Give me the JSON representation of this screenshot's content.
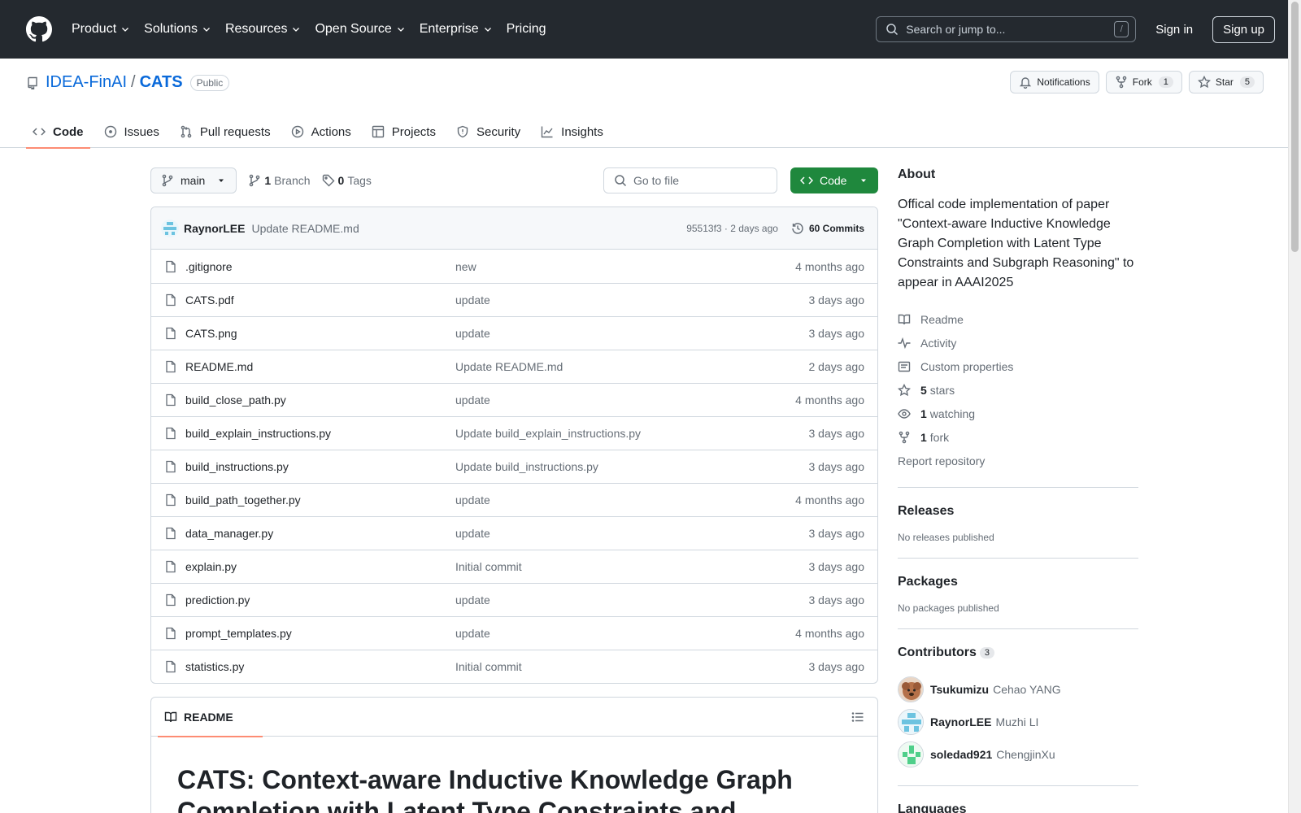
{
  "header": {
    "nav": [
      "Product",
      "Solutions",
      "Resources",
      "Open Source",
      "Enterprise",
      "Pricing"
    ],
    "search_placeholder": "Search or jump to...",
    "search_key": "/",
    "sign_in": "Sign in",
    "sign_up": "Sign up"
  },
  "repo": {
    "owner": "IDEA-FinAI",
    "separator": "/",
    "name": "CATS",
    "visibility": "Public",
    "notifications_label": "Notifications",
    "fork_label": "Fork",
    "fork_count": "1",
    "star_label": "Star",
    "star_count": "5",
    "tabs": [
      "Code",
      "Issues",
      "Pull requests",
      "Actions",
      "Projects",
      "Security",
      "Insights"
    ]
  },
  "toolbar": {
    "branch": "main",
    "branch_count": "1",
    "branch_label": "Branch",
    "tag_count": "0",
    "tag_label": "Tags",
    "goto_placeholder": "Go to file",
    "code_label": "Code"
  },
  "commit": {
    "author": "RaynorLEE",
    "message": "Update README.md",
    "meta": "95513f3 · 2 days ago",
    "count_label": "60 Commits"
  },
  "files": [
    {
      "name": ".gitignore",
      "message": "new",
      "age": "4 months ago"
    },
    {
      "name": "CATS.pdf",
      "message": "update",
      "age": "3 days ago"
    },
    {
      "name": "CATS.png",
      "message": "update",
      "age": "3 days ago"
    },
    {
      "name": "README.md",
      "message": "Update README.md",
      "age": "2 days ago"
    },
    {
      "name": "build_close_path.py",
      "message": "update",
      "age": "4 months ago"
    },
    {
      "name": "build_explain_instructions.py",
      "message": "Update build_explain_instructions.py",
      "age": "3 days ago"
    },
    {
      "name": "build_instructions.py",
      "message": "Update build_instructions.py",
      "age": "3 days ago"
    },
    {
      "name": "build_path_together.py",
      "message": "update",
      "age": "4 months ago"
    },
    {
      "name": "data_manager.py",
      "message": "update",
      "age": "3 days ago"
    },
    {
      "name": "explain.py",
      "message": "Initial commit",
      "age": "3 days ago"
    },
    {
      "name": "prediction.py",
      "message": "update",
      "age": "3 days ago"
    },
    {
      "name": "prompt_templates.py",
      "message": "update",
      "age": "4 months ago"
    },
    {
      "name": "statistics.py",
      "message": "Initial commit",
      "age": "3 days ago"
    }
  ],
  "readme": {
    "tab_label": "README",
    "title": "CATS: Context-aware Inductive Knowledge Graph Completion with Latent Type Constraints and"
  },
  "about": {
    "heading": "About",
    "description": "Offical code implementation of paper \"Context-aware Inductive Knowledge Graph Completion with Latent Type Constraints and Subgraph Reasoning\" to appear in AAAI2025",
    "readme": "Readme",
    "activity": "Activity",
    "custom_properties": "Custom properties",
    "stars_count": "5",
    "stars_label": "stars",
    "watching_count": "1",
    "watching_label": "watching",
    "forks_count": "1",
    "forks_label": "fork",
    "report": "Report repository"
  },
  "releases": {
    "heading": "Releases",
    "empty": "No releases published"
  },
  "packages": {
    "heading": "Packages",
    "empty": "No packages published"
  },
  "contributors": {
    "heading": "Contributors",
    "count": "3",
    "list": [
      {
        "login": "Tsukumizu",
        "name": "Cehao YANG"
      },
      {
        "login": "RaynorLEE",
        "name": "Muzhi LI"
      },
      {
        "login": "soledad921",
        "name": "ChengjinXu"
      }
    ]
  },
  "languages_heading": "Languages",
  "colors": {
    "header_bg": "#24292f",
    "link": "#0969da",
    "code_button": "#1f883d",
    "tab_underline": "#fd8c73"
  }
}
